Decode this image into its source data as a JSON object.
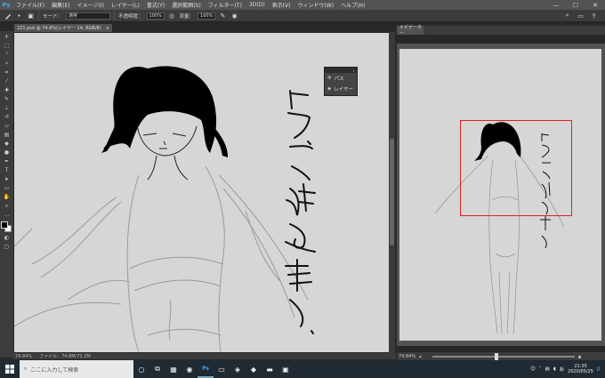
{
  "app": {
    "logo": "Ps"
  },
  "menu": [
    "ファイル(F)",
    "編集(E)",
    "イメージ(I)",
    "レイヤー(L)",
    "書式(Y)",
    "選択範囲(S)",
    "フィルター(T)",
    "3D(D)",
    "表示(V)",
    "ウィンドウ(W)",
    "ヘルプ(H)"
  ],
  "window_controls": {
    "minimize": "—",
    "maximize": "☐",
    "close": "✕"
  },
  "options": {
    "mode_label": "モード：",
    "mode_value": "通常",
    "opacity_label": "不透明度：",
    "opacity_value": "100%",
    "flow_label": "流量：",
    "flow_value": "100%"
  },
  "document_tab": {
    "title": "221.psd @ 74.8%(レイヤー 14, RGB/8)",
    "close": "×"
  },
  "canvas_text": "ドラゴン娘を描く。",
  "mini_panel": {
    "items": [
      {
        "label": "パス"
      },
      {
        "label": "レイヤー"
      }
    ]
  },
  "status": {
    "zoom": "74.84%",
    "file": "ファイル：74.8M/72.2M"
  },
  "navigator": {
    "tab_label": "ナビゲーター",
    "zoom": "74.84%",
    "zoom_level": 0.45
  },
  "taskbar": {
    "search_placeholder": "ここに入力して検索",
    "time": "21:35",
    "date": "2020/05/25"
  },
  "colors": {
    "accent": "#31a8ff",
    "navigator_frame": "#e02020",
    "canvas_bg": "#d6d6d6"
  }
}
